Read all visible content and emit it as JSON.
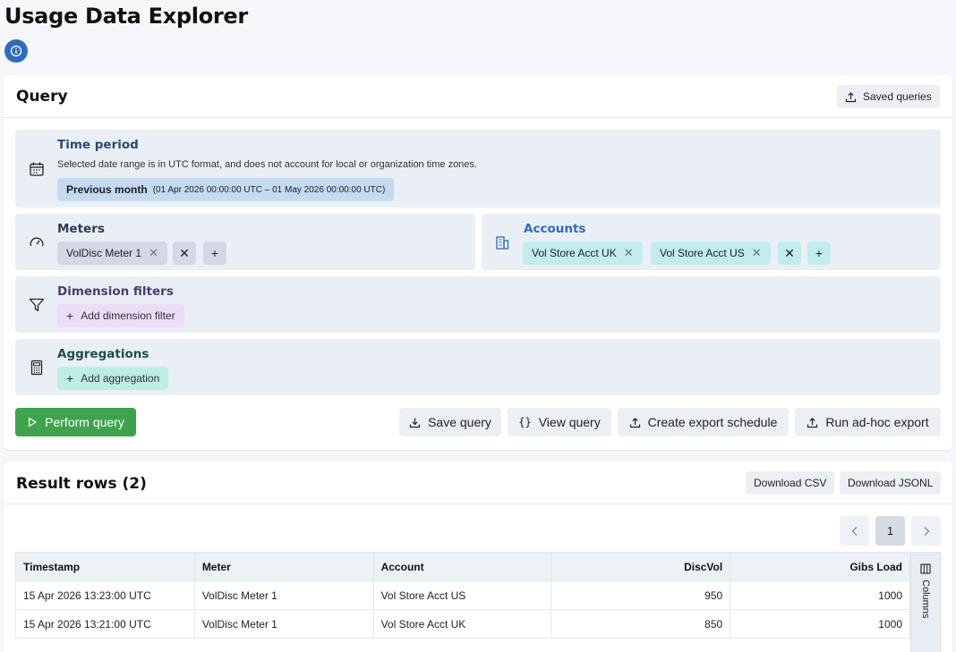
{
  "page": {
    "title": "Usage Data Explorer"
  },
  "query": {
    "title": "Query",
    "saved_queries_label": "Saved queries",
    "time_period": {
      "title": "Time period",
      "note": "Selected date range is in UTC format, and does not account for local or organization time zones.",
      "preset": "Previous month",
      "range": "(01 Apr 2026 00:00:00 UTC – 01 May 2026 00:00:00 UTC)"
    },
    "meters": {
      "title": "Meters",
      "chips": [
        "VolDisc Meter 1"
      ]
    },
    "accounts": {
      "title": "Accounts",
      "chips": [
        "Vol Store Acct UK",
        "Vol Store Acct US"
      ]
    },
    "dimension_filters": {
      "title": "Dimension filters",
      "add_label": "Add dimension filter"
    },
    "aggregations": {
      "title": "Aggregations",
      "add_label": "Add aggregation"
    },
    "actions": {
      "perform": "Perform query",
      "save": "Save query",
      "view": "View query",
      "schedule": "Create export schedule",
      "adhoc": "Run ad-hoc export"
    }
  },
  "results": {
    "title": "Result rows (2)",
    "download_csv": "Download CSV",
    "download_jsonl": "Download JSONL",
    "current_page": "1",
    "columns_label": "Columns",
    "headers": [
      "Timestamp",
      "Meter",
      "Account",
      "DiscVol",
      "Gibs Load"
    ],
    "rows": [
      [
        "15 Apr 2026 13:23:00 UTC",
        "VolDisc Meter 1",
        "Vol Store Acct US",
        "950",
        "1000"
      ],
      [
        "15 Apr 2026 13:21:00 UTC",
        "VolDisc Meter 1",
        "Vol Store Acct UK",
        "850",
        "1000"
      ]
    ]
  },
  "colors": {
    "primary_green": "#3fa34d",
    "link_green": "#3c9a4a",
    "info_blue": "#2d6bbd",
    "time_chip": "#c5d9f1",
    "meter_chip": "#d3d7e6",
    "account_chip": "#c2ecee",
    "filter_chip": "#ecdcf6",
    "agg_chip": "#bdeee4"
  },
  "icons": {
    "info": "info-circle-icon",
    "calendar": "calendar-icon",
    "gauge": "gauge-icon",
    "building": "building-icon",
    "filter": "filter-icon",
    "calculator": "calculator-icon",
    "upload": "upload-icon",
    "download": "download-icon",
    "code": "code-braces-icon",
    "play": "play-icon",
    "columns": "columns-icon"
  }
}
